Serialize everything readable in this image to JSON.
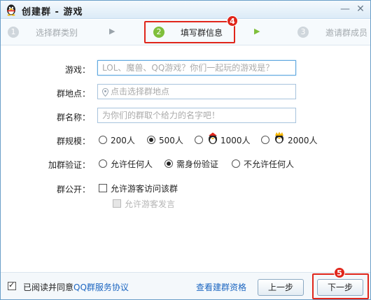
{
  "window": {
    "title": "创建群 - 游戏",
    "minimize": "—",
    "close": "✕"
  },
  "steps": [
    {
      "num": "1",
      "label": "选择群类别",
      "state": "done"
    },
    {
      "num": "2",
      "label": "填写群信息",
      "state": "active"
    },
    {
      "num": "3",
      "label": "邀请群成员",
      "state": "pending"
    }
  ],
  "annotations": {
    "step_badge": "4",
    "next_badge": "5"
  },
  "form": {
    "game_label": "游戏：",
    "game_placeholder": "LOL、魔兽、QQ游戏？你们一起玩的游戏是？",
    "location_label": "群地点：",
    "location_placeholder": "点击选择群地点",
    "name_label": "群名称：",
    "name_placeholder": "为你们的群取个给力的名字吧！",
    "size_label": "群规模：",
    "size_options": [
      "200人",
      "500人",
      "1000人",
      "2000人"
    ],
    "size_selected": "500人",
    "verify_label": "加群验证：",
    "verify_options": [
      "允许任何人",
      "需身份验证",
      "不允许任何人"
    ],
    "verify_selected": "需身份验证",
    "public_label": "群公开：",
    "public_guest_visit": "允许游客访问该群",
    "public_guest_post": "允许游客发言"
  },
  "footer": {
    "agree_text": "已阅读并同意",
    "agreement_link": "QQ群服务协议",
    "qualification_link": "查看建群资格",
    "prev_button": "上一步",
    "next_button": "下一步"
  },
  "colors": {
    "accent_green": "#7fbf3b",
    "annotation_red": "#e0261b",
    "link_blue": "#1c66c1"
  }
}
